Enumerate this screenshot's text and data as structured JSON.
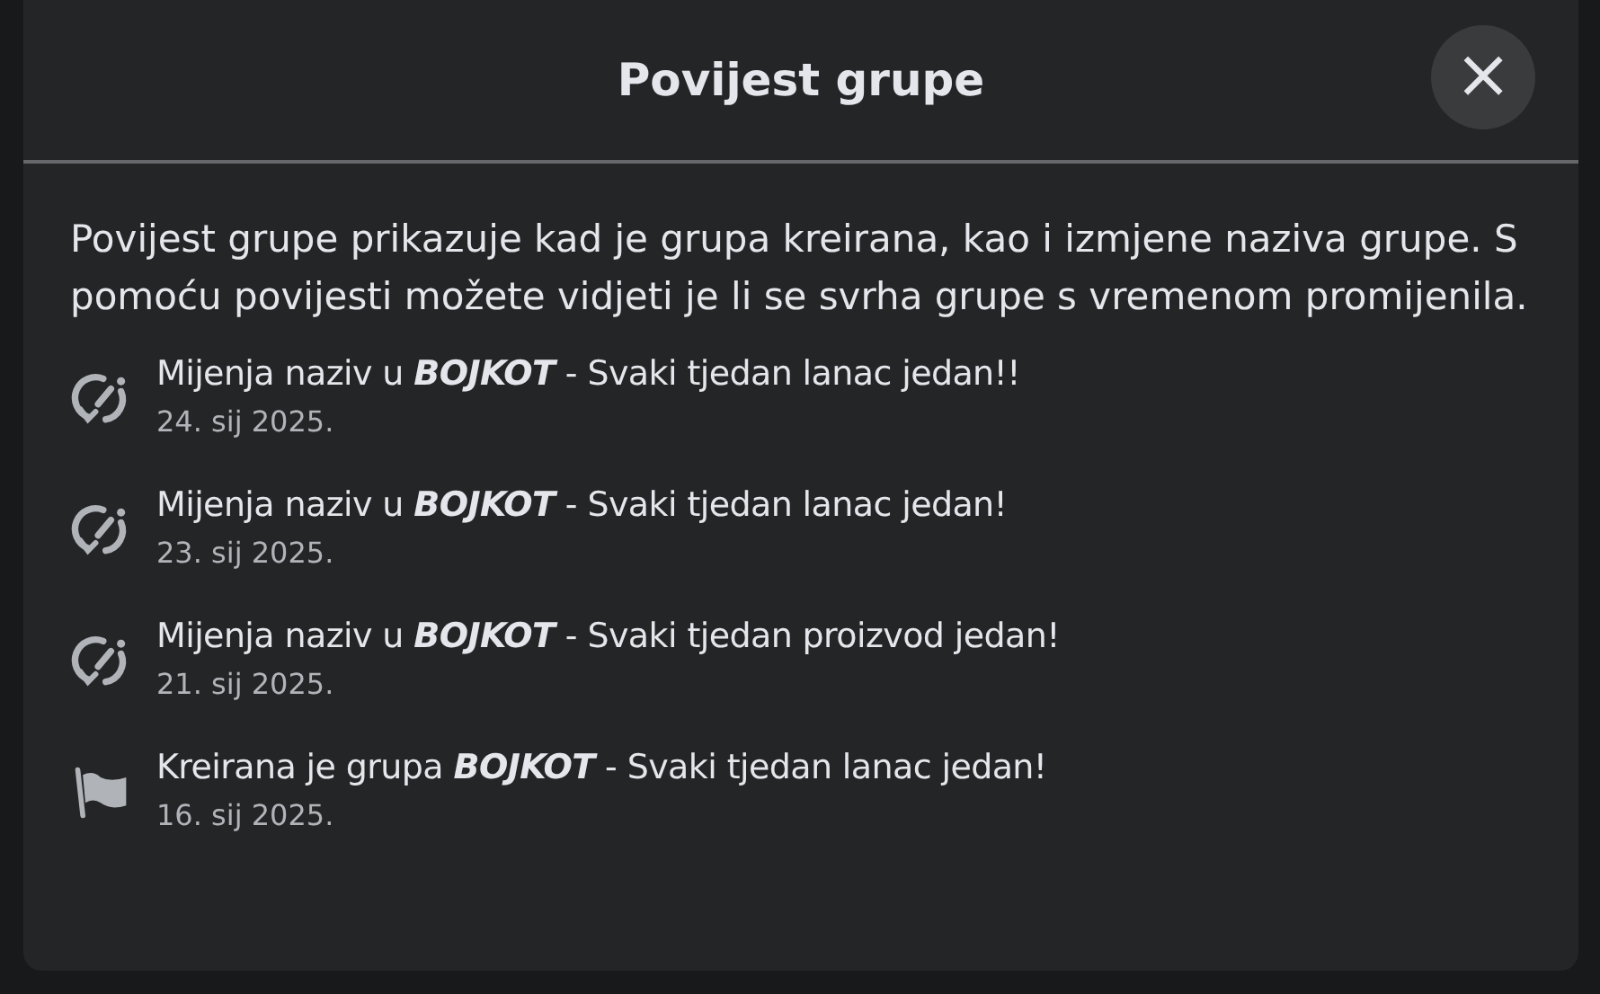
{
  "dialog": {
    "title": "Povijest grupe",
    "close_label": "×",
    "description": "Povijest grupe prikazuje kad je grupa kreirana, kao i izmjene naziva grupe. S pomoću povijesti možete vidjeti je li se svrha grupe s vremenom promijenila.",
    "events": [
      {
        "kind": "rename",
        "text": "Mijenja naziv u **BOJKOT** - Svaki tjedan lanac jedan!!",
        "date": "24. sij 2025."
      },
      {
        "kind": "rename",
        "text": "Mijenja naziv u **BOJKOT** - Svaki tjedan lanac jedan!",
        "date": "23. sij 2025."
      },
      {
        "kind": "rename",
        "text": "Mijenja naziv u **BOJKOT** - Svaki tjedan proizvod jedan!",
        "date": "21. sij 2025."
      },
      {
        "kind": "created",
        "text": "Kreirana je grupa **BOJKOT** - Svaki tjedan lanac jedan!",
        "date": "16. sij 2025."
      }
    ]
  }
}
